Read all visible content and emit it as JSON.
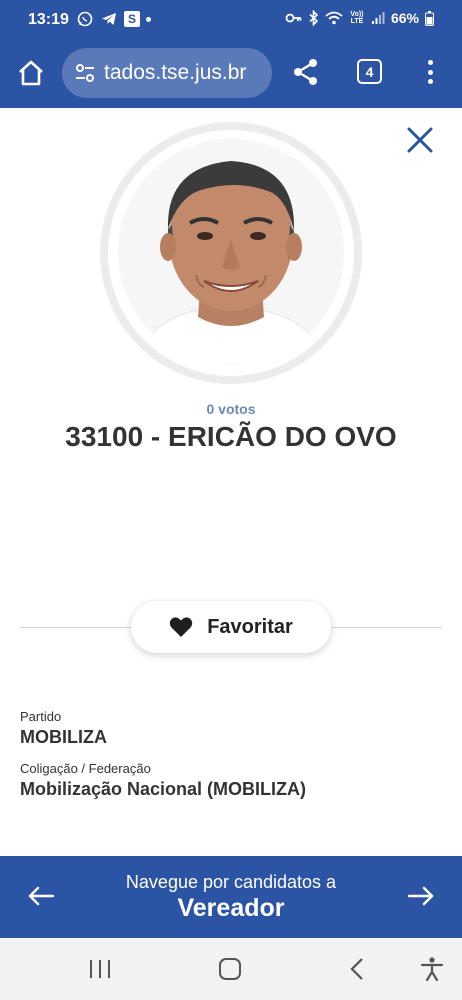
{
  "status_bar": {
    "time": "13:19",
    "battery": "66%",
    "left_icons": [
      "whatsapp-icon",
      "telegram-icon",
      "s-app-icon",
      "dot"
    ],
    "right_icons": [
      "key-icon",
      "bluetooth-icon",
      "wifi-icon",
      "volte-icon",
      "signal-icon",
      "battery-icon"
    ],
    "s_icon_letter": "S",
    "volte_label": "Vo)) LTE"
  },
  "browser": {
    "url": "tados.tse.jus.br",
    "tab_count": "4"
  },
  "candidate": {
    "votes": "0 votos",
    "name": "33100 - ERICÃO DO OVO"
  },
  "favorite": {
    "label": "Favoritar"
  },
  "details": {
    "party_label": "Partido",
    "party_value": "MOBILIZA",
    "coalition_label": "Coligação / Federação",
    "coalition_value": "Mobilização Nacional (MOBILIZA)"
  },
  "navigator": {
    "caption": "Navegue por candidatos a",
    "role": "Vereador"
  },
  "colors": {
    "brand_blue": "#2c54a4",
    "votes_text": "#6a8ab5"
  }
}
